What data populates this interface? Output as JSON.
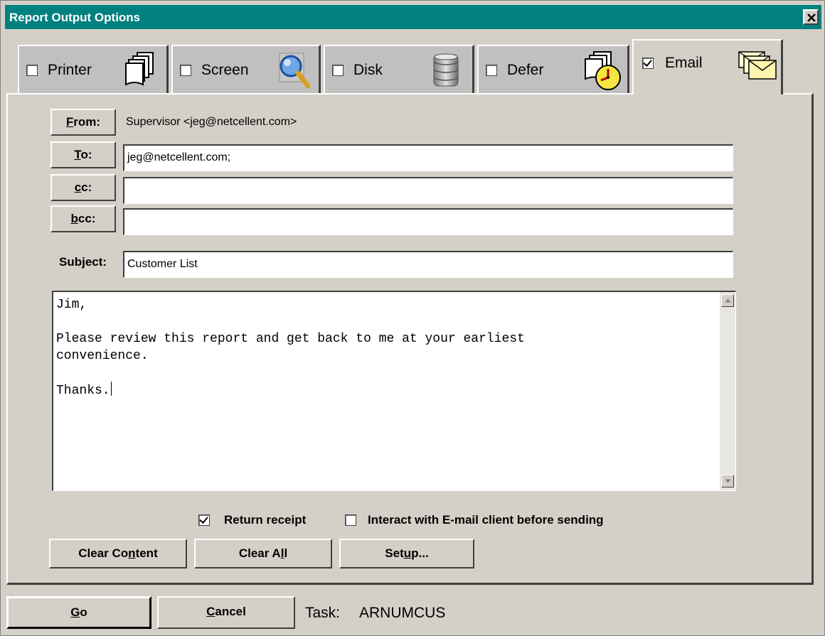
{
  "window": {
    "title": "Report Output Options"
  },
  "tabs": [
    {
      "label": "Printer",
      "checked": false,
      "icon": "printer-pages-icon"
    },
    {
      "label": "Screen",
      "checked": false,
      "icon": "magnifier-screen-icon"
    },
    {
      "label": "Disk",
      "checked": false,
      "icon": "disk-stack-icon"
    },
    {
      "label": "Defer",
      "checked": false,
      "icon": "deferred-clock-icon"
    },
    {
      "label": "Email",
      "checked": true,
      "icon": "envelopes-icon"
    }
  ],
  "email": {
    "from_button": {
      "prefix": "",
      "accel": "F",
      "rest": "rom:"
    },
    "from_value": "Supervisor <jeg@netcellent.com>",
    "to_button": {
      "accel": "T",
      "rest": "o:"
    },
    "to_value": "jeg@netcellent.com;",
    "cc_button": {
      "accel": "c",
      "rest": "c:"
    },
    "cc_value": "",
    "bcc_button": {
      "accel": "b",
      "rest": "cc:"
    },
    "bcc_value": "",
    "subject_label": "Subject:",
    "subject_value": "Customer List",
    "body": "Jim,\n\nPlease review this report and get back to me at your earliest\nconvenience.\n\nThanks.",
    "return_receipt_label": "Return receipt",
    "return_receipt_checked": true,
    "interact_label": "Interact with E-mail client before sending",
    "interact_checked": false,
    "clear_content": {
      "a": "Clear Co",
      "accel": "n",
      "b": "tent"
    },
    "clear_all": {
      "a": "Clear A",
      "accel": "l",
      "b": "l"
    },
    "setup": {
      "a": "Set",
      "accel": "u",
      "b": "p..."
    }
  },
  "footer": {
    "go": {
      "accel": "G",
      "rest": "o"
    },
    "cancel": {
      "accel": "C",
      "rest": "ancel"
    },
    "task_label": "Task:",
    "task_value": "ARNUMCUS"
  }
}
